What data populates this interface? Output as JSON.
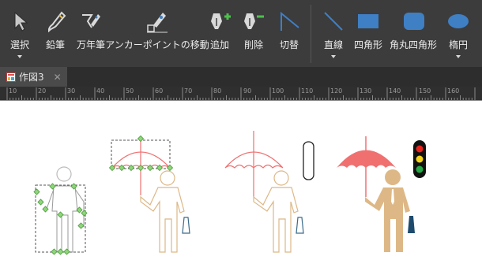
{
  "toolbar": {
    "tools": [
      {
        "label": "選択",
        "icon": "pointer-icon",
        "caret": true
      },
      {
        "label": "鉛筆",
        "icon": "pencil-icon",
        "caret": false
      },
      {
        "label": "万年筆",
        "icon": "fountain-pen-icon",
        "caret": false
      },
      {
        "label": "アンカーポイントの移動",
        "icon": "anchor-move-icon",
        "caret": false
      },
      {
        "label": "追加",
        "icon": "anchor-add-icon",
        "caret": false
      },
      {
        "label": "削除",
        "icon": "anchor-delete-icon",
        "caret": false
      },
      {
        "label": "切替",
        "icon": "anchor-convert-icon",
        "caret": false
      },
      {
        "label": "直線",
        "icon": "line-icon",
        "caret": true
      },
      {
        "label": "四角形",
        "icon": "rectangle-icon",
        "caret": false
      },
      {
        "label": "角丸四角形",
        "icon": "rounded-rectangle-icon",
        "caret": false
      },
      {
        "label": "楕円",
        "icon": "ellipse-icon",
        "caret": true
      }
    ]
  },
  "tab": {
    "title": "作図3",
    "close": "✕",
    "icon": "document-icon"
  },
  "ruler": {
    "marks": [
      "10",
      "20",
      "30",
      "40",
      "50",
      "60",
      "70",
      "80",
      "90",
      "100",
      "110",
      "120",
      "130",
      "140",
      "150",
      "160"
    ]
  },
  "colors": {
    "toolbar_bg": "#3c3c3c",
    "accent_blue": "#3f7fc4",
    "umbrella_red": "#f07070",
    "figure_tan": "#ddb886",
    "selection_green": "#7ec86e",
    "traffic_red": "#e8231c",
    "traffic_yellow": "#f2d21b",
    "traffic_green": "#27a745"
  }
}
